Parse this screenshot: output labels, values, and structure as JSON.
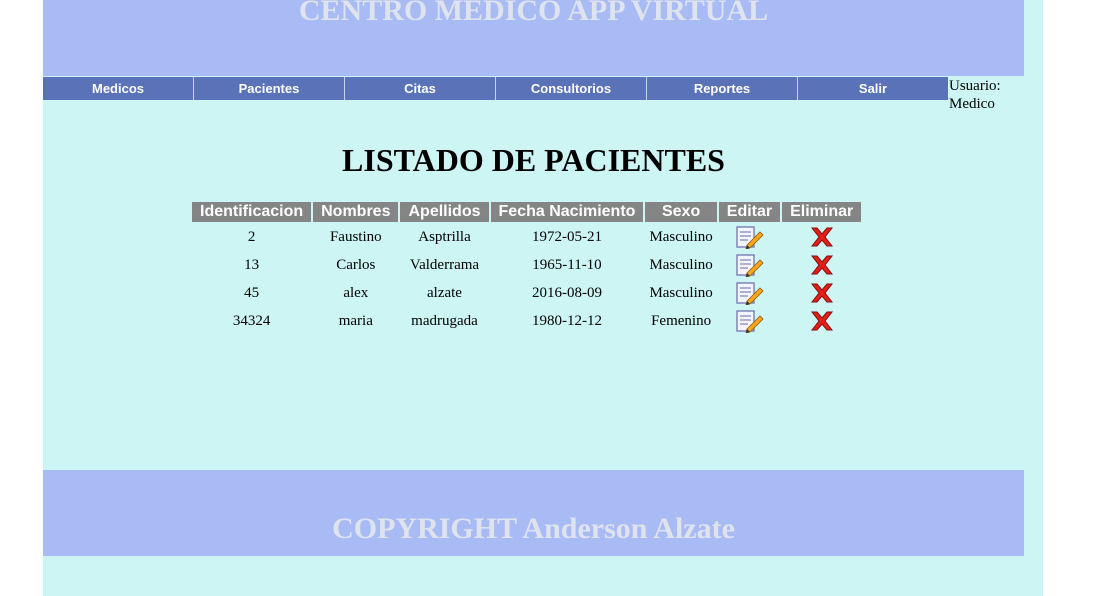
{
  "header": {
    "title": "CENTRO MEDICO APP VIRTUAL"
  },
  "nav": {
    "items": [
      "Medicos",
      "Pacientes",
      "Citas",
      "Consultorios",
      "Reportes",
      "Salir"
    ]
  },
  "user": {
    "label": "Usuario:",
    "name": "Medico"
  },
  "main": {
    "title": "LISTADO DE PACIENTES",
    "columns": [
      "Identificacion",
      "Nombres",
      "Apellidos",
      "Fecha Nacimiento",
      "Sexo",
      "Editar",
      "Eliminar"
    ],
    "rows": [
      {
        "id": "2",
        "nombres": "Faustino",
        "apellidos": "Asptrilla",
        "fecha": "1972-05-21",
        "sexo": "Masculino"
      },
      {
        "id": "13",
        "nombres": "Carlos",
        "apellidos": "Valderrama",
        "fecha": "1965-11-10",
        "sexo": "Masculino"
      },
      {
        "id": "45",
        "nombres": "alex",
        "apellidos": "alzate",
        "fecha": "2016-08-09",
        "sexo": "Masculino"
      },
      {
        "id": "34324",
        "nombres": "maria",
        "apellidos": "madrugada",
        "fecha": "1980-12-12",
        "sexo": "Femenino"
      }
    ],
    "icons": {
      "edit": "edit-document-icon",
      "delete": "delete-x-icon"
    }
  },
  "footer": {
    "copyright": "COPYRIGHT Anderson Alzate"
  },
  "colors": {
    "page_bg": "#ccf5f4",
    "header_bg": "#a9bbf5",
    "nav_bg": "#5a72b8",
    "table_header_bg": "#858585"
  }
}
